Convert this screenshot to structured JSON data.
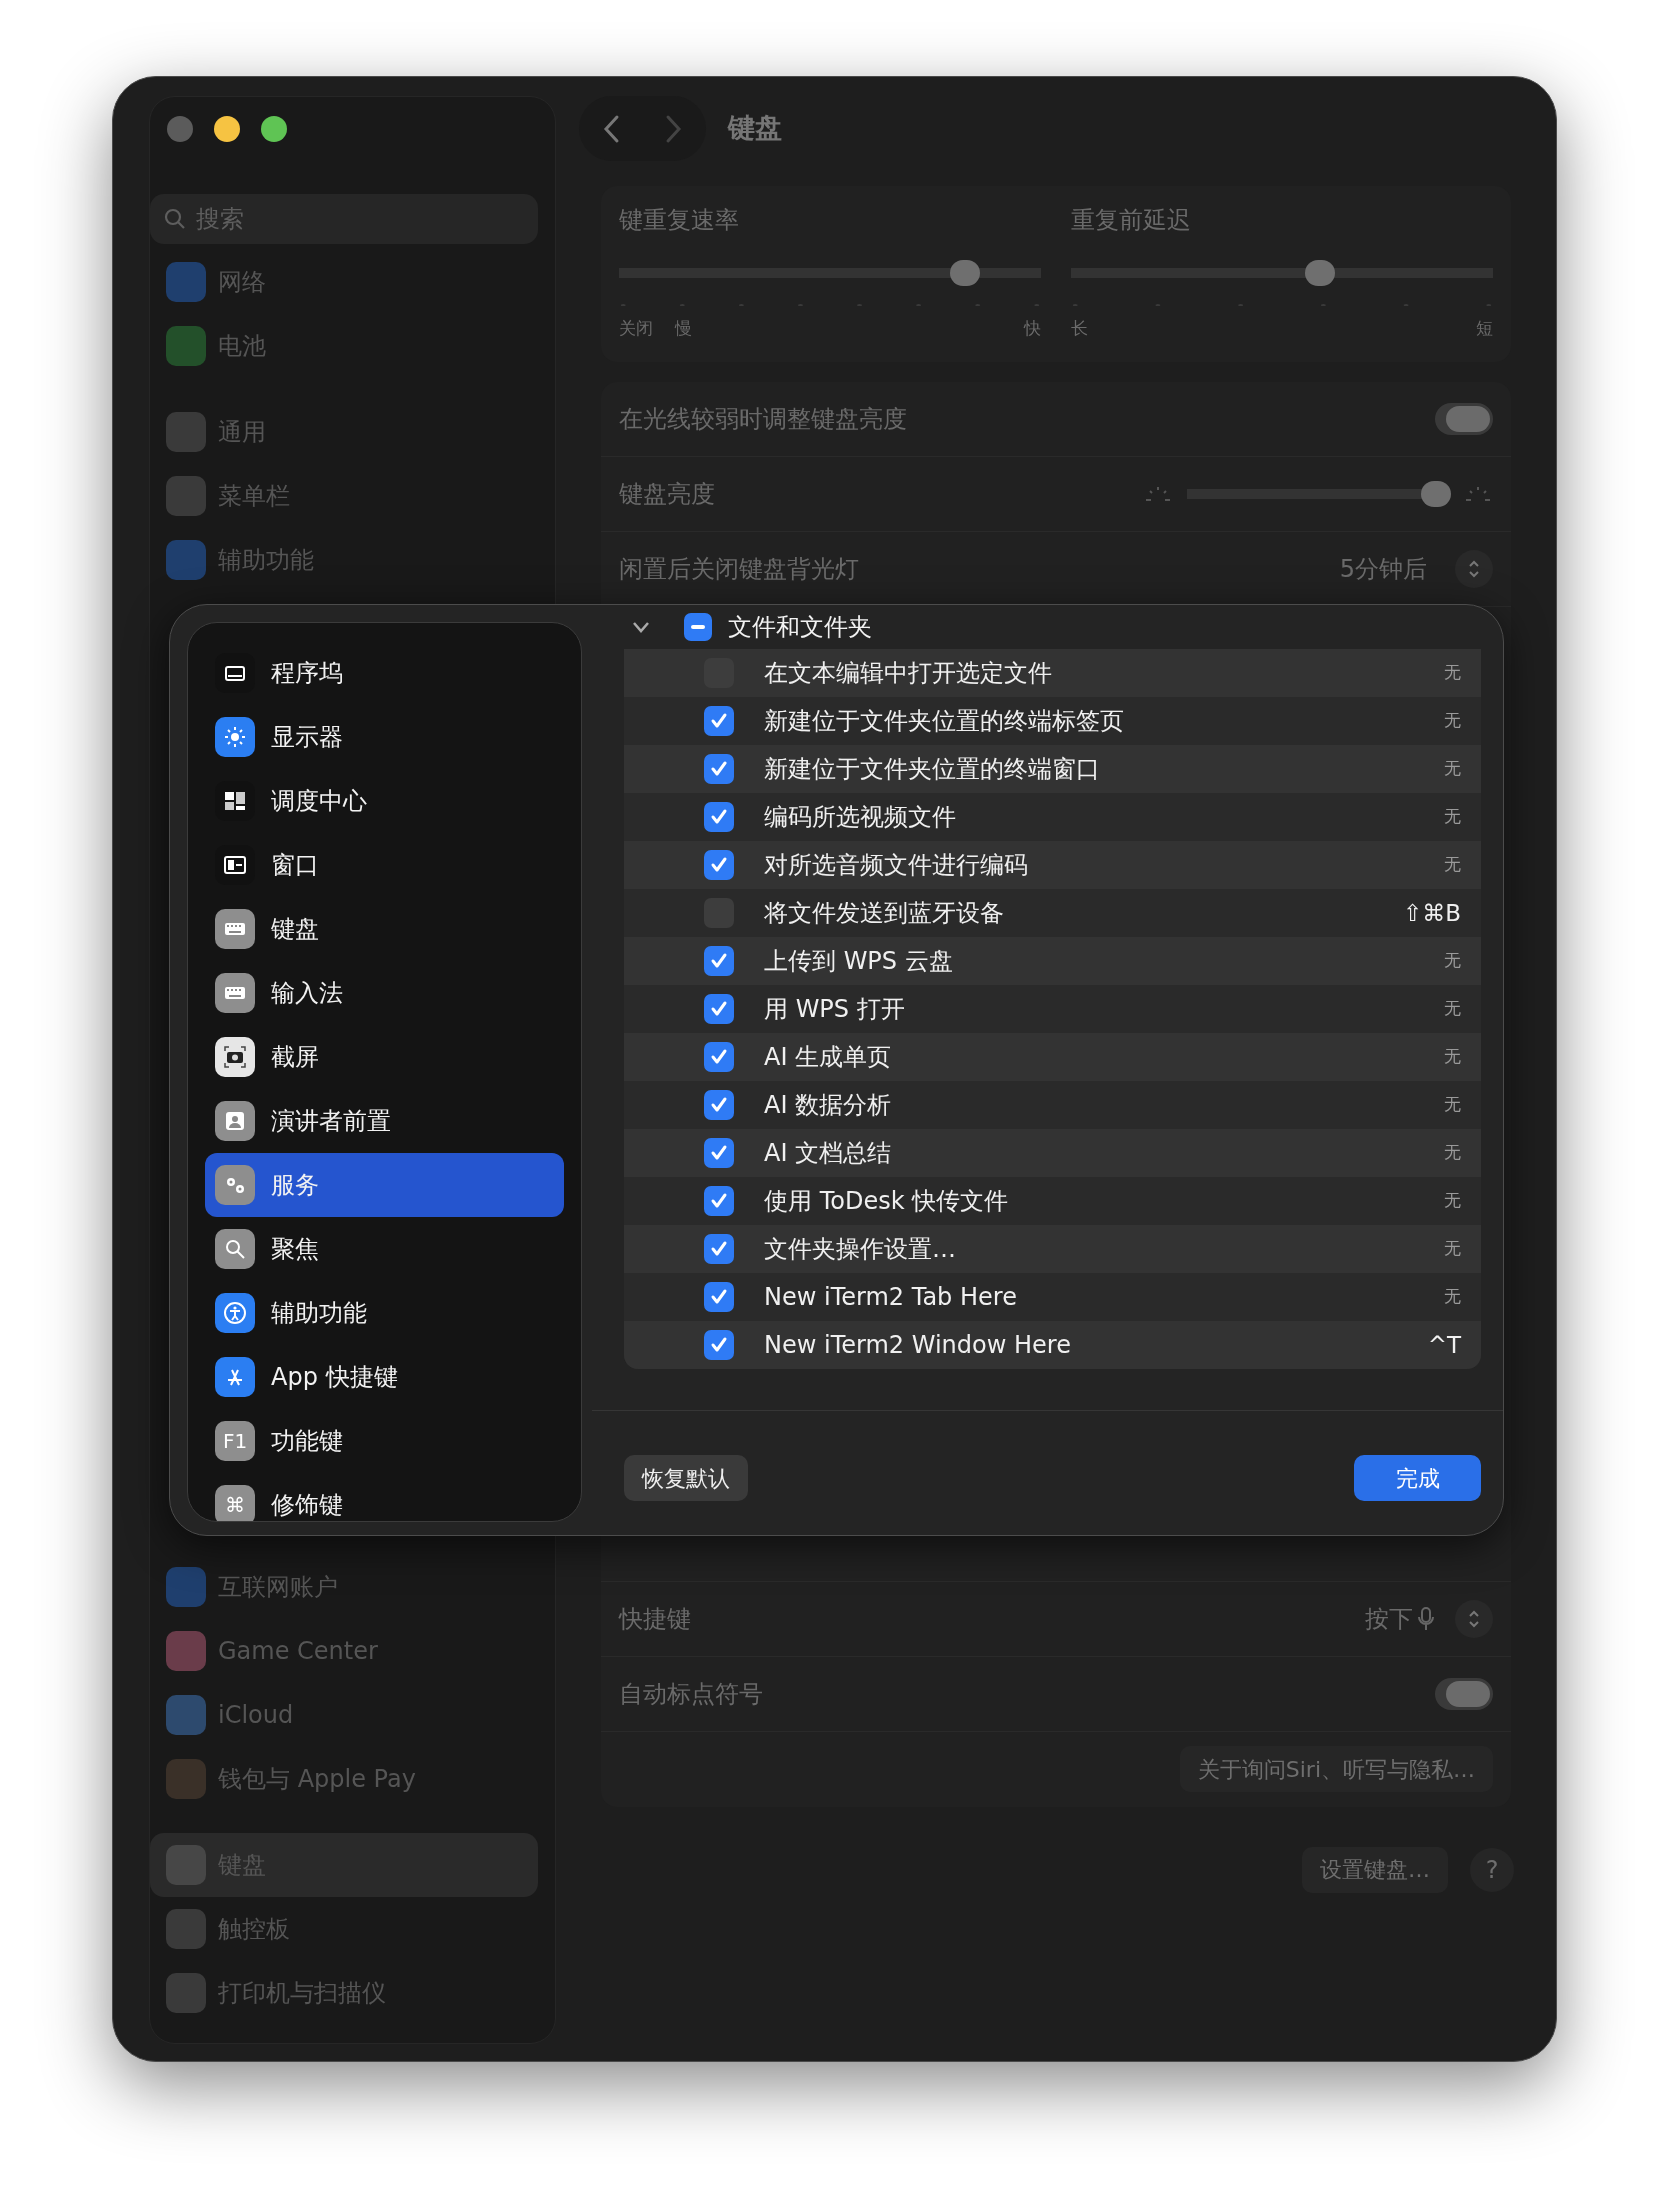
{
  "window": {
    "traffic_lights": [
      {
        "color": "#5b5b5b"
      },
      {
        "color": "#f6c342"
      },
      {
        "color": "#5fc454"
      }
    ]
  },
  "sidebar": {
    "search": {
      "placeholder": "搜索"
    },
    "sections_top": [
      {
        "items": [
          {
            "label": "网络",
            "color": "#1f3f6e",
            "selected": false
          },
          {
            "label": "电池",
            "color": "#23502a",
            "selected": false
          }
        ]
      },
      {
        "items": [
          {
            "label": "通用",
            "color": "#3a3a3a",
            "selected": false
          },
          {
            "label": "菜单栏",
            "color": "#3a3a3a",
            "selected": false
          },
          {
            "label": "辅助功能",
            "color": "#1f3f6e",
            "selected": false
          }
        ]
      }
    ],
    "sections_bottom": [
      {
        "items": [
          {
            "label": "互联网账户",
            "color": "#1f3f6e",
            "selected": false
          },
          {
            "label": "Game Center",
            "color": "#6a3c4a",
            "selected": false
          },
          {
            "label": "iCloud",
            "color": "#2d4a6e",
            "selected": false
          },
          {
            "label": "钱包与 Apple Pay",
            "color": "#3a3028",
            "selected": false
          }
        ]
      },
      {
        "items": [
          {
            "label": "键盘",
            "color": "#474747",
            "selected": true
          },
          {
            "label": "触控板",
            "color": "#3a3a3a",
            "selected": false
          },
          {
            "label": "打印机与扫描仪",
            "color": "#3a3a3a",
            "selected": false
          }
        ]
      }
    ]
  },
  "header": {
    "title": "键盘"
  },
  "repeat_sliders": [
    {
      "label": "键重复速率",
      "level": 0.82,
      "min_labels": [
        "关闭",
        "慢"
      ],
      "max_label": "快"
    },
    {
      "label": "重复前延迟",
      "level": 0.59,
      "min_labels": [
        "长"
      ],
      "max_label": "短"
    }
  ],
  "settings_top": [
    {
      "kind": "toggle",
      "label": "在光线较弱时调整键盘亮度",
      "on": true
    },
    {
      "kind": "slider",
      "label": "键盘亮度",
      "level": 0.95
    },
    {
      "kind": "select",
      "label": "闲置后关闭键盘背光灯",
      "value": "5分钟后"
    }
  ],
  "settings_bottom": [
    {
      "kind": "mic-select",
      "label": "快捷键",
      "value": "按下"
    },
    {
      "kind": "toggle",
      "label": "自动标点符号",
      "on": true
    },
    {
      "kind": "button",
      "label": "关于询问Siri、听写与隐私…"
    }
  ],
  "footer_buttons": [
    {
      "label": "设置键盘…",
      "kind": "pill"
    },
    {
      "label": "?",
      "kind": "circle"
    }
  ],
  "sheet": {
    "sidebar": [
      {
        "label": "程序坞",
        "color": "#111111",
        "selected": false
      },
      {
        "label": "显示器",
        "color": "#2b7ef2",
        "selected": false
      },
      {
        "label": "调度中心",
        "color": "#111111",
        "selected": false
      },
      {
        "label": "窗口",
        "color": "#111111",
        "selected": false
      },
      {
        "label": "键盘",
        "color": "#8e8e8e",
        "selected": false
      },
      {
        "label": "输入法",
        "color": "#8e8e8e",
        "selected": false
      },
      {
        "label": "截屏",
        "color": "#e6e6e6",
        "selected": false
      },
      {
        "label": "演讲者前置",
        "color": "#8e8e8e",
        "selected": false
      },
      {
        "label": "服务",
        "color": "#8e8e8e",
        "selected": true
      },
      {
        "label": "聚焦",
        "color": "#8e8e8e",
        "selected": false
      },
      {
        "label": "辅助功能",
        "color": "#2b7ef2",
        "selected": false
      },
      {
        "label": "App 快捷键",
        "color": "#2b7ef2",
        "selected": false
      },
      {
        "label": "功能键",
        "color": "#8e8e8e",
        "selected": false,
        "icon_text": "F1"
      },
      {
        "label": "修饰键",
        "color": "#8e8e8e",
        "selected": false,
        "icon_text": "⌘"
      }
    ],
    "group": {
      "label": "文件和文件夹",
      "expanded": true,
      "checked": true,
      "partial": true
    },
    "services": [
      {
        "label": "在文本编辑中打开选定文件",
        "checked": false,
        "shortcut": "无",
        "assigned": false
      },
      {
        "label": "新建位于文件夹位置的终端标签页",
        "checked": true,
        "shortcut": "无",
        "assigned": false
      },
      {
        "label": "新建位于文件夹位置的终端窗口",
        "checked": true,
        "shortcut": "无",
        "assigned": false
      },
      {
        "label": "编码所选视频文件",
        "checked": true,
        "shortcut": "无",
        "assigned": false
      },
      {
        "label": "对所选音频文件进行编码",
        "checked": true,
        "shortcut": "无",
        "assigned": false
      },
      {
        "label": "将文件发送到蓝牙设备",
        "checked": false,
        "shortcut": "⇧⌘B",
        "assigned": true
      },
      {
        "label": "上传到 WPS 云盘",
        "checked": true,
        "shortcut": "无",
        "assigned": false
      },
      {
        "label": "用 WPS 打开",
        "checked": true,
        "shortcut": "无",
        "assigned": false
      },
      {
        "label": "AI 生成单页",
        "checked": true,
        "shortcut": "无",
        "assigned": false
      },
      {
        "label": "AI 数据分析",
        "checked": true,
        "shortcut": "无",
        "assigned": false
      },
      {
        "label": "AI 文档总结",
        "checked": true,
        "shortcut": "无",
        "assigned": false
      },
      {
        "label": "使用 ToDesk 快传文件",
        "checked": true,
        "shortcut": "无",
        "assigned": false
      },
      {
        "label": "文件夹操作设置…",
        "checked": true,
        "shortcut": "无",
        "assigned": false
      },
      {
        "label": "New iTerm2 Tab Here",
        "checked": true,
        "shortcut": "无",
        "assigned": false
      },
      {
        "label": "New iTerm2 Window Here",
        "checked": true,
        "shortcut": "^T",
        "assigned": true
      }
    ],
    "buttons": [
      {
        "label": "恢复默认",
        "kind": "secondary"
      },
      {
        "label": "完成",
        "kind": "primary"
      }
    ]
  }
}
